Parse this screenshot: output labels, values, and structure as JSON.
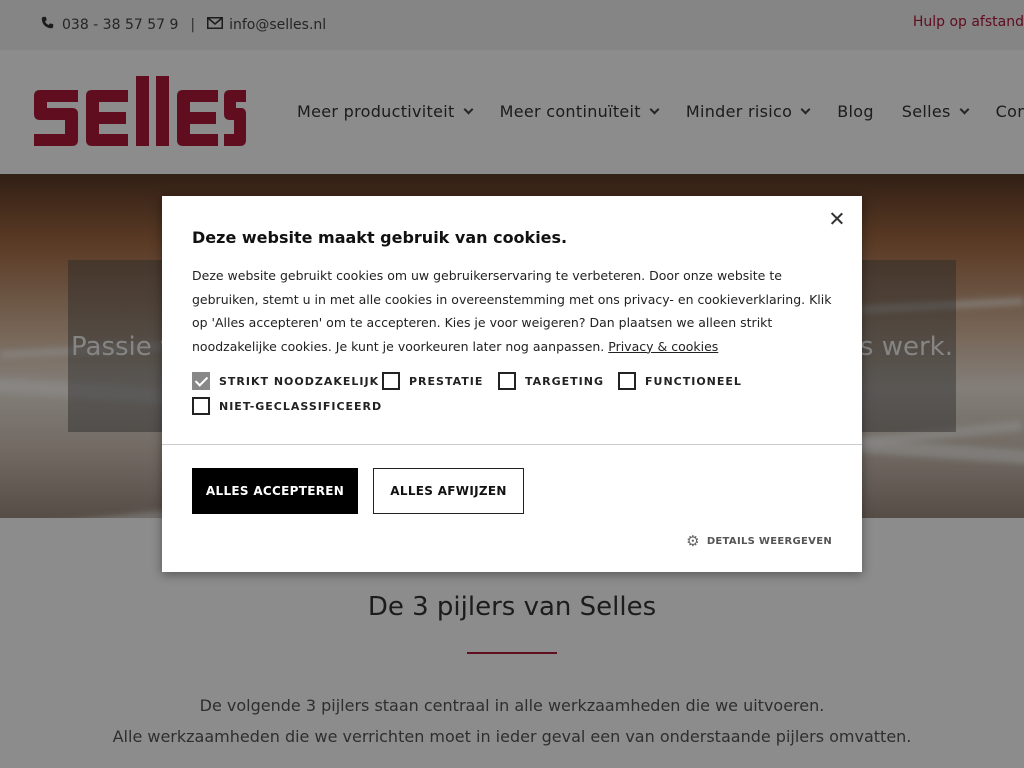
{
  "topbar": {
    "phone": "038 - 38 57 57 9",
    "separator": "|",
    "email": "info@selles.nl",
    "help_link": "Hulp op afstand",
    "phone_icon": "phone-icon",
    "email_icon": "envelope-icon"
  },
  "header": {
    "logo_text": "SELLES",
    "brand_color": "#b01839",
    "nav": [
      {
        "label": "Meer productiviteit",
        "has_dropdown": true
      },
      {
        "label": "Meer continuïteit",
        "has_dropdown": true
      },
      {
        "label": "Minder risico",
        "has_dropdown": true
      },
      {
        "label": "Blog",
        "has_dropdown": false
      },
      {
        "label": "Selles",
        "has_dropdown": true
      },
      {
        "label": "Contact",
        "has_dropdown": false
      }
    ]
  },
  "hero": {
    "tagline_left": "Passie v",
    "tagline_right": "ns werk."
  },
  "pillars": {
    "title": "De 3 pijlers van Selles",
    "line1": "De volgende 3 pijlers staan centraal in alle werkzaamheden die we uitvoeren.",
    "line2": "Alle werkzaamheden die we verrichten moet in ieder geval een van onderstaande pijlers omvatten."
  },
  "cookie": {
    "title": "Deze website maakt gebruik van cookies.",
    "body": "Deze website gebruikt cookies om uw gebruikerservaring te verbeteren. Door onze website te gebruiken, stemt u in met alle cookies in overeenstemming met ons privacy- en cookieverklaring. Klik op 'Alles accepteren' om te accepteren. Kies je voor weigeren? Dan plaatsen we alleen strikt noodzakelijke cookies. Je kunt je voorkeuren later nog aanpassen.",
    "policy_link": "Privacy & cookies",
    "categories": [
      {
        "label": "STRIKT NOODZAKELIJK",
        "checked": true
      },
      {
        "label": "PRESTATIE",
        "checked": false
      },
      {
        "label": "TARGETING",
        "checked": false
      },
      {
        "label": "FUNCTIONEEL",
        "checked": false
      },
      {
        "label": "NIET-GECLASSIFICEERD",
        "checked": false
      }
    ],
    "accept_label": "ALLES ACCEPTEREN",
    "reject_label": "ALLES AFWIJZEN",
    "details_label": "DETAILS WEERGEVEN",
    "details_icon": "gear-icon",
    "close_icon": "close-icon"
  }
}
